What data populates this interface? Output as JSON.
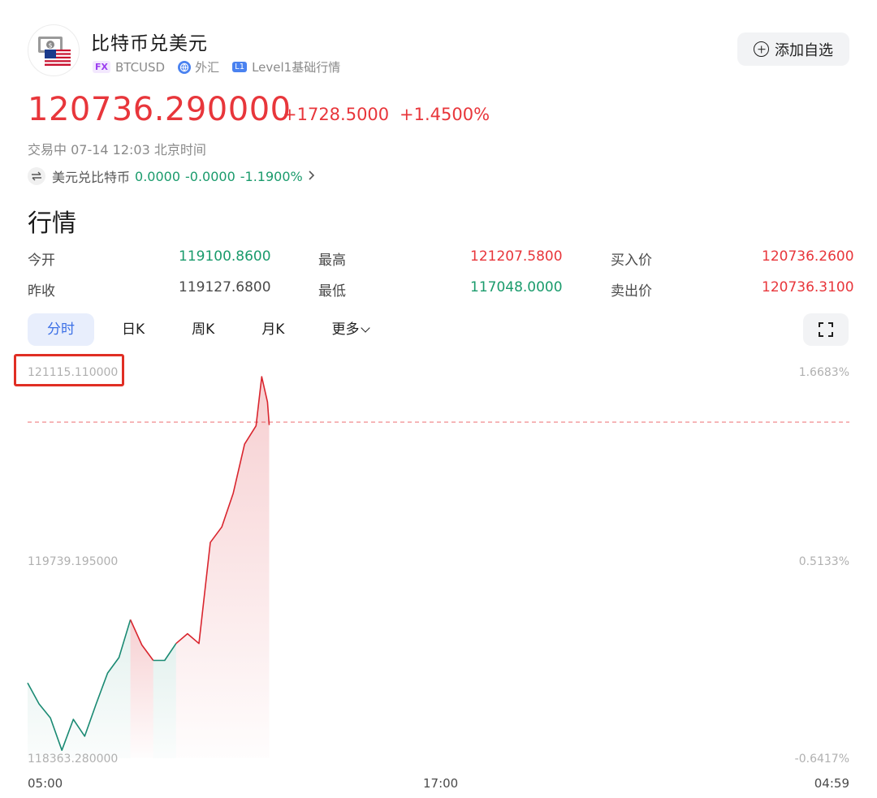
{
  "header": {
    "title": "比特币兑美元",
    "fx_badge": "FX",
    "symbol": "BTCUSD",
    "market": "外汇",
    "level_badge": "L1",
    "level": "Level1基础行情",
    "watch_label": "添加自选"
  },
  "quote": {
    "price": "120736.290000",
    "change": "+1728.5000",
    "change_pct": "+1.4500%",
    "status": "交易中 07-14 12:03 北京时间"
  },
  "inverse": {
    "pair": "美元兑比特币",
    "price": "0.0000",
    "change": "-0.0000",
    "change_pct": "-1.1900%"
  },
  "section_title": "行情",
  "stats": {
    "open_label": "今开",
    "open": "119100.8600",
    "high_label": "最高",
    "high": "121207.5800",
    "bid_label": "买入价",
    "bid": "120736.2600",
    "prev_close_label": "昨收",
    "prev_close": "119127.6800",
    "low_label": "最低",
    "low": "117048.0000",
    "ask_label": "卖出价",
    "ask": "120736.3100"
  },
  "tabs": [
    {
      "label": "分时",
      "active": true
    },
    {
      "label": "日K"
    },
    {
      "label": "周K"
    },
    {
      "label": "月K"
    },
    {
      "label": "更多"
    }
  ],
  "chart_data": {
    "type": "line",
    "title": "",
    "xlabel": "",
    "ylabel": "",
    "ylim": [
      118363.28,
      121115.11
    ],
    "y_ticks": [
      "121115.110000",
      "119739.195000",
      "118363.280000"
    ],
    "pct_ticks": [
      "1.6683%",
      "0.5133%",
      "-0.6417%"
    ],
    "x_ticks": [
      "05:00",
      "17:00",
      "04:59"
    ],
    "reference_price": 119127.68,
    "up_color": "#d9252e",
    "down_color": "#1a8a73",
    "series": [
      {
        "x": [
          "05:00",
          "05:20",
          "05:40",
          "06:00",
          "06:20",
          "06:40",
          "07:00",
          "07:20",
          "07:40",
          "08:00",
          "08:20",
          "08:40",
          "09:00",
          "09:20",
          "09:40",
          "10:00",
          "10:20",
          "10:40",
          "11:00",
          "11:20",
          "11:40",
          "11:50",
          "12:00",
          "12:03"
        ],
        "y": [
          118900,
          118750,
          118650,
          118420,
          118640,
          118520,
          118750,
          118970,
          119080,
          119350,
          119170,
          119060,
          119060,
          119180,
          119250,
          119180,
          119900,
          120010,
          120250,
          120600,
          120730,
          121080,
          120900,
          120736
        ]
      }
    ]
  },
  "icons": {
    "avatar": "usd-btc-flag-icon",
    "globe": "globe-icon",
    "swap": "swap-icon",
    "chevron": "chevron-right-icon",
    "plus": "plus-circle-icon",
    "fullscreen": "fullscreen-icon"
  }
}
